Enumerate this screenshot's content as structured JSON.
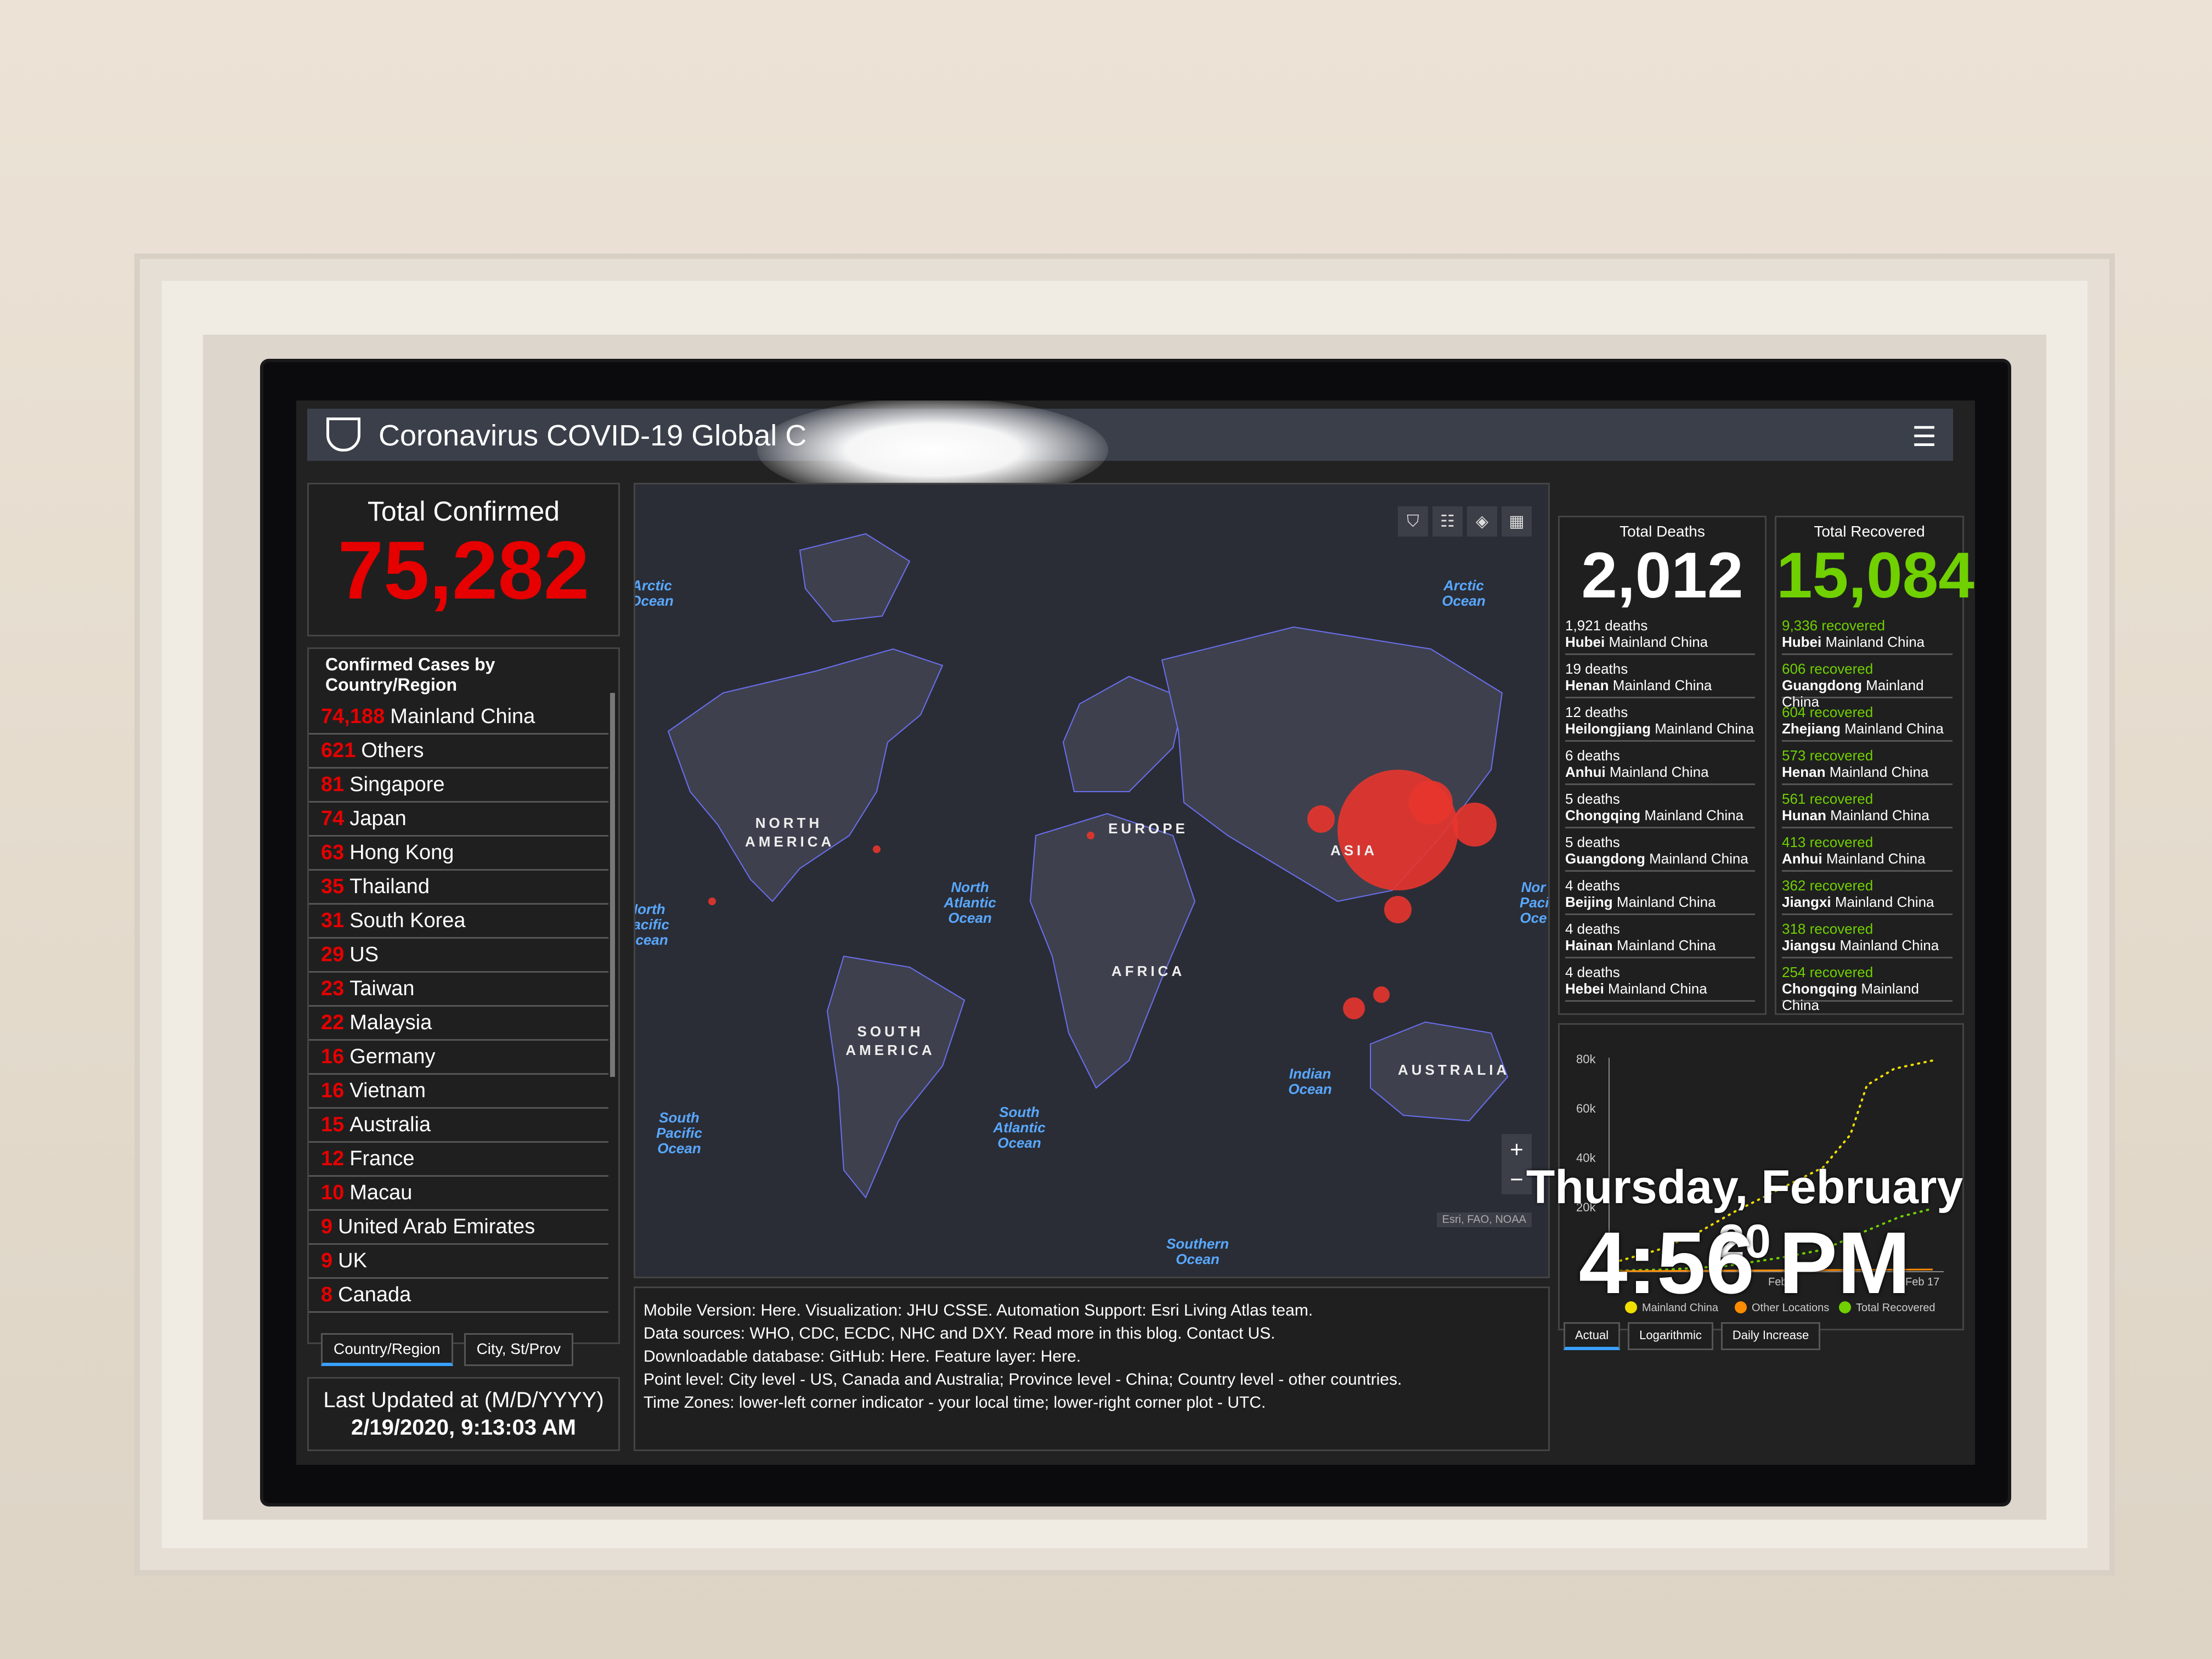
{
  "header": {
    "title": "Coronavirus COVID-19 Global C"
  },
  "total_confirmed": {
    "label": "Total Confirmed",
    "value": "75,282"
  },
  "cases_list": {
    "heading": "Confirmed Cases by Country/Region",
    "rows": [
      {
        "count": "74,188",
        "place": "Mainland China"
      },
      {
        "count": "621",
        "place": "Others"
      },
      {
        "count": "81",
        "place": "Singapore"
      },
      {
        "count": "74",
        "place": "Japan"
      },
      {
        "count": "63",
        "place": "Hong Kong"
      },
      {
        "count": "35",
        "place": "Thailand"
      },
      {
        "count": "31",
        "place": "South Korea"
      },
      {
        "count": "29",
        "place": "US"
      },
      {
        "count": "23",
        "place": "Taiwan"
      },
      {
        "count": "22",
        "place": "Malaysia"
      },
      {
        "count": "16",
        "place": "Germany"
      },
      {
        "count": "16",
        "place": "Vietnam"
      },
      {
        "count": "15",
        "place": "Australia"
      },
      {
        "count": "12",
        "place": "France"
      },
      {
        "count": "10",
        "place": "Macau"
      },
      {
        "count": "9",
        "place": "United Arab Emirates"
      },
      {
        "count": "9",
        "place": "UK"
      },
      {
        "count": "8",
        "place": "Canada"
      }
    ],
    "tabs": [
      "Country/Region",
      "City, St/Prov"
    ]
  },
  "last_updated": {
    "label": "Last Updated at (M/D/YYYY)",
    "value": "2/19/2020, 9:13:03 AM"
  },
  "map": {
    "oceans": [
      "Arctic Ocean",
      "North Atlantic Ocean",
      "North Pacific Ocean",
      "South Pacific Ocean",
      "South Atlantic Ocean",
      "Indian Ocean",
      "Southern Ocean",
      "Arctic Ocean",
      "Nor Paci Oce"
    ],
    "continents": [
      "NORTH AMERICA",
      "SOUTH AMERICA",
      "EUROPE",
      "AFRICA",
      "ASIA",
      "AUSTRALIA"
    ],
    "attribution": "Esri, FAO, NOAA"
  },
  "info": {
    "line1": "Mobile Version: Here. Visualization: JHU CSSE. Automation Support: Esri Living Atlas team.",
    "line2": "Data sources: WHO, CDC, ECDC, NHC and DXY. Read more in this blog. Contact US.",
    "line3": "Downloadable database: GitHub: Here. Feature layer: Here.",
    "line4": "Point level: City level - US, Canada and Australia; Province level - China; Country level - other countries.",
    "line5": "Time Zones: lower-left corner indicator - your local time; lower-right corner plot - UTC."
  },
  "deaths": {
    "label": "Total Deaths",
    "value": "2,012",
    "rows": [
      {
        "count": "1,921 deaths",
        "place": "Hubei",
        "region": "Mainland China"
      },
      {
        "count": "19 deaths",
        "place": "Henan",
        "region": "Mainland China"
      },
      {
        "count": "12 deaths",
        "place": "Heilongjiang",
        "region": "Mainland China"
      },
      {
        "count": "6 deaths",
        "place": "Anhui",
        "region": "Mainland China"
      },
      {
        "count": "5 deaths",
        "place": "Chongqing",
        "region": "Mainland China"
      },
      {
        "count": "5 deaths",
        "place": "Guangdong",
        "region": "Mainland China"
      },
      {
        "count": "4 deaths",
        "place": "Beijing",
        "region": "Mainland China"
      },
      {
        "count": "4 deaths",
        "place": "Hainan",
        "region": "Mainland China"
      },
      {
        "count": "4 deaths",
        "place": "Hebei",
        "region": "Mainland China"
      }
    ]
  },
  "recovered": {
    "label": "Total Recovered",
    "value": "15,084",
    "rows": [
      {
        "count": "9,336 recovered",
        "place": "Hubei",
        "region": "Mainland China"
      },
      {
        "count": "606 recovered",
        "place": "Guangdong",
        "region": "Mainland China"
      },
      {
        "count": "604 recovered",
        "place": "Zhejiang",
        "region": "Mainland China"
      },
      {
        "count": "573 recovered",
        "place": "Henan",
        "region": "Mainland China"
      },
      {
        "count": "561 recovered",
        "place": "Hunan",
        "region": "Mainland China"
      },
      {
        "count": "413 recovered",
        "place": "Anhui",
        "region": "Mainland China"
      },
      {
        "count": "362 recovered",
        "place": "Jiangxi",
        "region": "Mainland China"
      },
      {
        "count": "318 recovered",
        "place": "Jiangsu",
        "region": "Mainland China"
      },
      {
        "count": "254 recovered",
        "place": "Chongqing",
        "region": "Mainland China"
      }
    ]
  },
  "chart": {
    "yticks": [
      "80k",
      "60k",
      "40k",
      "20k"
    ],
    "xticks": [
      "Feb",
      "Feb 17"
    ],
    "legend": [
      "Mainland China",
      "Other Locations",
      "Total Recovered"
    ],
    "tabs": [
      "Actual",
      "Logarithmic",
      "Daily Increase"
    ],
    "colors": {
      "mainland": "#f0e000",
      "other": "#ff8c00",
      "recovered": "#70d000"
    }
  },
  "overlay": {
    "date": "Thursday, February 20",
    "time": "4:56 PM"
  },
  "colors": {
    "confirmed": "#e60000",
    "recovered": "#70d000",
    "link": "#39a0ff",
    "panel_bg": "#1f1f1f"
  },
  "icons": [
    "shield-logo-icon",
    "hamburger-menu-icon",
    "bookmark-icon",
    "list-icon",
    "layers-icon",
    "qr-icon",
    "zoom-in-icon",
    "zoom-out-icon"
  ]
}
